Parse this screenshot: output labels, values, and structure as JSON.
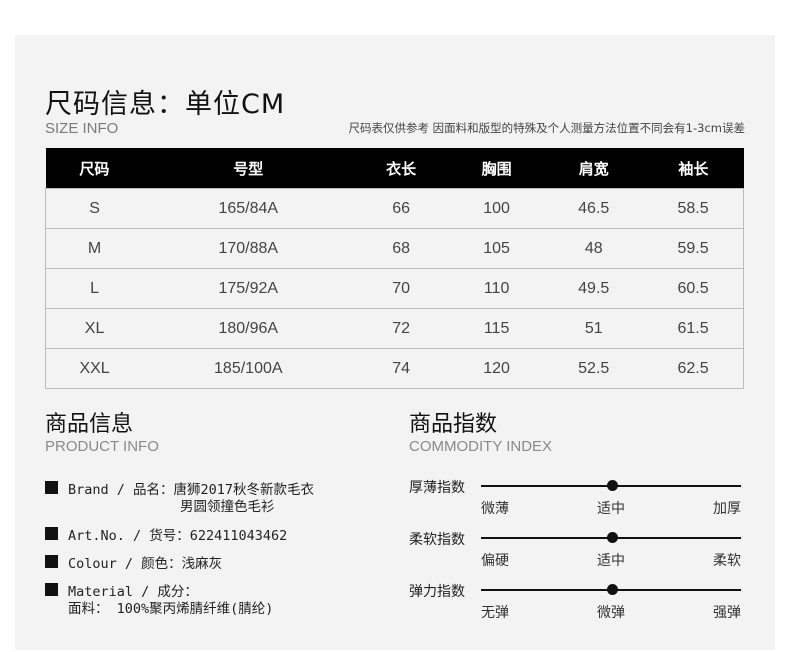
{
  "size_info": {
    "title": "尺码信息：单位CM",
    "subtitle": "SIZE INFO",
    "note": "尺码表仅供参考 因面料和版型的特殊及个人测量方法位置不同会有1-3cm误差",
    "headers": [
      "尺码",
      "号型",
      "衣长",
      "胸围",
      "肩宽",
      "袖长"
    ],
    "rows": [
      [
        "S",
        "165/84A",
        "66",
        "100",
        "46.5",
        "58.5"
      ],
      [
        "M",
        "170/88A",
        "68",
        "105",
        "48",
        "59.5"
      ],
      [
        "L",
        "175/92A",
        "70",
        "110",
        "49.5",
        "60.5"
      ],
      [
        "XL",
        "180/96A",
        "72",
        "115",
        "51",
        "61.5"
      ],
      [
        "XXL",
        "185/100A",
        "74",
        "120",
        "52.5",
        "62.5"
      ]
    ]
  },
  "product_info": {
    "title": "商品信息",
    "subtitle": "PRODUCT INFO",
    "brand_line1": "Brand / 品名：唐狮2017秋冬新款毛衣",
    "brand_line2": "男圆领撞色毛衫",
    "art_no": "Art.No. / 货号：622411043462",
    "colour": "Colour / 颜色：浅麻灰",
    "material_line1": "Material / 成分：",
    "material_line2": "面料： 100%聚丙烯腈纤维(腈纶)"
  },
  "commodity_index": {
    "title": "商品指数",
    "subtitle": "COMMODITY INDEX",
    "indices": [
      {
        "label": "厚薄指数",
        "ticks": [
          "微薄",
          "适中",
          "加厚"
        ],
        "level": 0.5
      },
      {
        "label": "柔软指数",
        "ticks": [
          "偏硬",
          "适中",
          "柔软"
        ],
        "level": 0.5
      },
      {
        "label": "弹力指数",
        "ticks": [
          "无弹",
          "微弹",
          "强弹"
        ],
        "level": 0.5
      }
    ]
  }
}
